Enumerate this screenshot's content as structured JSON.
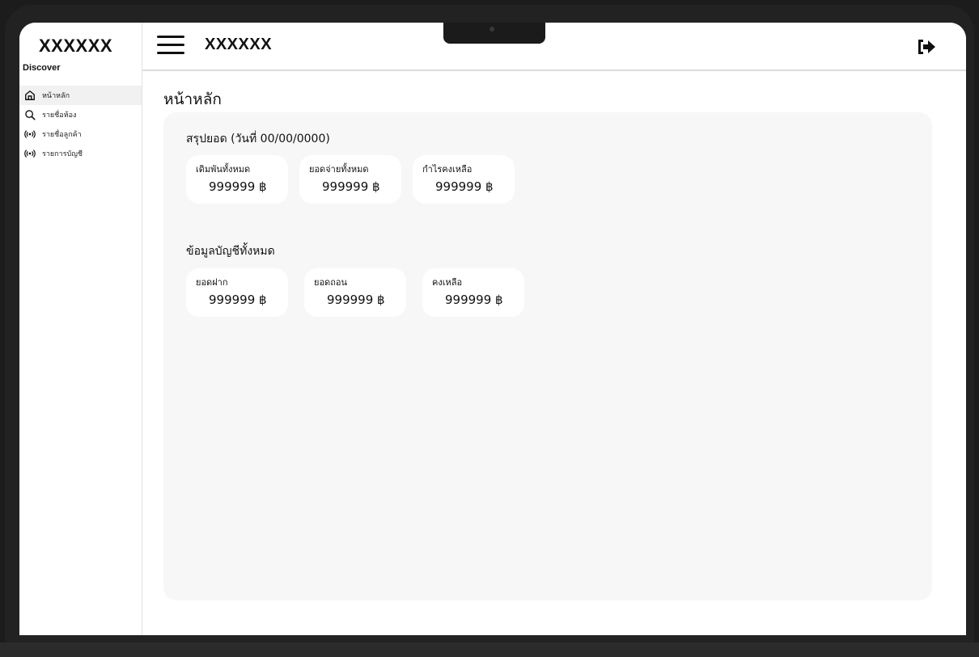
{
  "app": {
    "brand": "XXXXXX",
    "section_label": "Discover"
  },
  "sidebar": {
    "items": [
      {
        "label": "หน้าหลัก",
        "icon": "home-icon",
        "active": true
      },
      {
        "label": "รายชื่อห้อง",
        "icon": "search-icon",
        "active": false
      },
      {
        "label": "รายชื่อลูกค้า",
        "icon": "broadcast-icon",
        "active": false
      },
      {
        "label": "รายการบัญชี",
        "icon": "broadcast-icon",
        "active": false
      }
    ]
  },
  "header": {
    "title": "XXXXXX",
    "menu_icon": "hamburger-icon",
    "logout_icon": "logout-icon"
  },
  "main": {
    "page_title": "หน้าหลัก",
    "summary": {
      "title": "สรุปยอด (วันที่ 00/00/0000)",
      "cards": [
        {
          "label": "เดิมพันทั้งหมด",
          "value": "999999 ฿"
        },
        {
          "label": "ยอดจ่ายทั้งหมด",
          "value": "999999 ฿"
        },
        {
          "label": "กำไรคงเหลือ",
          "value": "999999 ฿"
        }
      ]
    },
    "accounts": {
      "title": "ข้อมูลบัญชีทั้งหมด",
      "cards": [
        {
          "label": "ยอดฝาก",
          "value": "999999 ฿"
        },
        {
          "label": "ยอดถอน",
          "value": "999999 ฿"
        },
        {
          "label": "คงเหลือ",
          "value": "999999 ฿"
        }
      ]
    }
  },
  "colors": {
    "panel": "#f7f7f7",
    "card": "#ffffff",
    "active_nav": "#f1f1f1",
    "frame": "#1c1c1c"
  }
}
